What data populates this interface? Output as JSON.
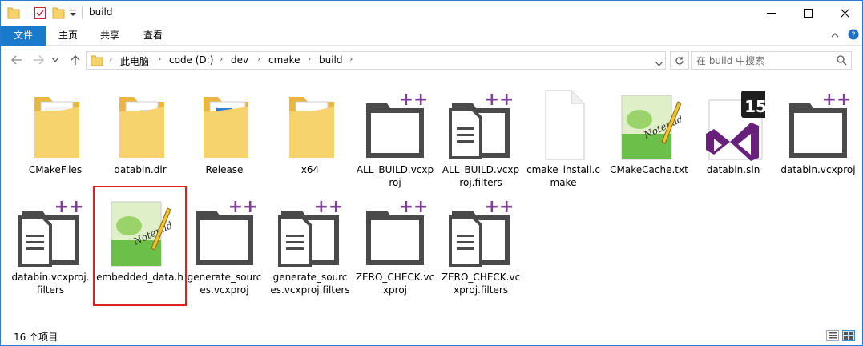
{
  "window": {
    "title": "build"
  },
  "ribbon": {
    "tabs": [
      {
        "label": "文件"
      },
      {
        "label": "主页"
      },
      {
        "label": "共享"
      },
      {
        "label": "查看"
      }
    ]
  },
  "address": {
    "breadcrumbs": [
      "此电脑",
      "code (D:)",
      "dev",
      "cmake",
      "build"
    ]
  },
  "search": {
    "placeholder": "在 build 中搜索"
  },
  "items": [
    {
      "label": "CMakeFiles",
      "icon": "folder-docs-icon"
    },
    {
      "label": "databin.dir",
      "icon": "folder-docs-icon"
    },
    {
      "label": "Release",
      "icon": "folder-docs-icon"
    },
    {
      "label": "x64",
      "icon": "folder-docs-icon"
    },
    {
      "label": "ALL_BUILD.vcxproj",
      "icon": "vcxproj-icon"
    },
    {
      "label": "ALL_BUILD.vcxproj.filters",
      "icon": "vcxproj-filters-icon"
    },
    {
      "label": "cmake_install.cmake",
      "icon": "blank-file-icon"
    },
    {
      "label": "CMakeCache.txt",
      "icon": "notepadpp-file-icon"
    },
    {
      "label": "databin.sln",
      "icon": "visual-studio-sln-icon"
    },
    {
      "label": "databin.vcxproj",
      "icon": "vcxproj-icon"
    },
    {
      "label": "databin.vcxproj.filters",
      "icon": "vcxproj-filters-icon"
    },
    {
      "label": "embedded_data.h",
      "icon": "notepadpp-file-icon"
    },
    {
      "label": "generate_sources.vcxproj",
      "icon": "vcxproj-icon"
    },
    {
      "label": "generate_sources.vcxproj.filters",
      "icon": "vcxproj-filters-icon"
    },
    {
      "label": "ZERO_CHECK.vcxproj",
      "icon": "vcxproj-icon"
    },
    {
      "label": "ZERO_CHECK.vcxproj.filters",
      "icon": "vcxproj-filters-icon"
    }
  ],
  "sln_badge": "15",
  "status": {
    "item_count": "16 个项目"
  },
  "colors": {
    "accent": "#1979ca",
    "highlight_border": "#e02020",
    "vs_purple": "#68217a",
    "folder_yellow": "#f5c94a"
  }
}
